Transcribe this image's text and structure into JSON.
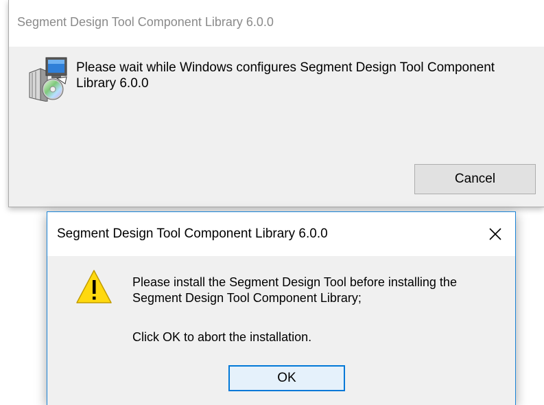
{
  "background_dialog": {
    "title": "Segment Design Tool Component Library 6.0.0",
    "message": "Please wait while Windows configures Segment Design Tool Component Library 6.0.0",
    "cancel_label": "Cancel",
    "icon": "installer-package-icon"
  },
  "alert_dialog": {
    "title": "Segment Design Tool Component Library 6.0.0",
    "message": "Please install the Segment Design Tool before installing the Segment Design Tool Component Library;",
    "instruction": "Click OK to abort the installation.",
    "ok_label": "OK",
    "icon": "warning-icon",
    "close_icon": "close-icon"
  },
  "colors": {
    "accent_border": "#1883d7",
    "ok_border": "#0078d7",
    "warning_fill": "#ffd90f",
    "dialog_bg": "#f0f0f0"
  }
}
